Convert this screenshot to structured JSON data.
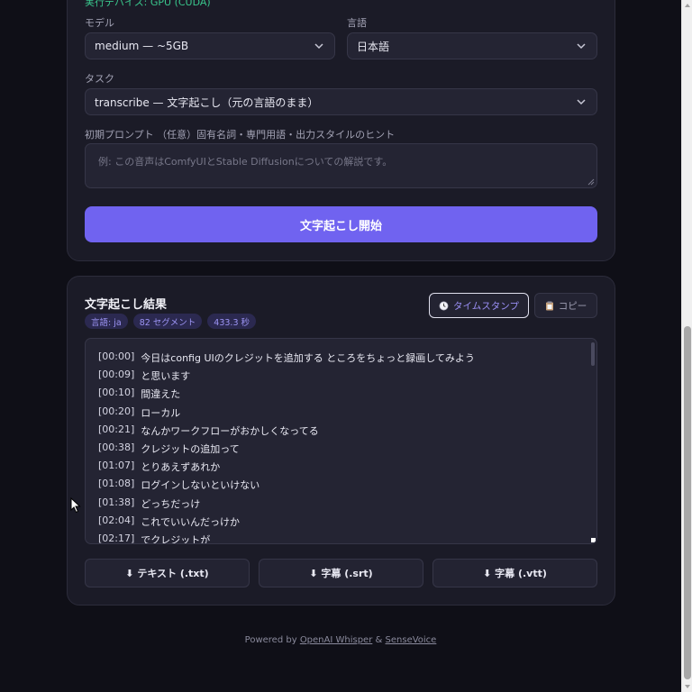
{
  "settings": {
    "cut_text": "実行デバイス: GPU (CUDA)",
    "model_label": "モデル",
    "model_value": "medium — ~5GB",
    "language_label": "言語",
    "language_value": "日本語",
    "task_label": "タスク",
    "task_value": "transcribe — 文字起こし（元の言語のまま）",
    "prompt_label": "初期プロンプト （任意）固有名詞・専門用語・出力スタイルのヒント",
    "prompt_placeholder": "例: この音声はComfyUIとStable Diffusionについての解説です。",
    "start_button": "文字起こし開始"
  },
  "result": {
    "title": "文字起こし結果",
    "badges": [
      "言語: ja",
      "82 セグメント",
      "433.3 秒"
    ],
    "timestamp_button": "タイムスタンプ",
    "copy_button": "コピー",
    "lines": [
      {
        "t": "[00:00]",
        "text": "今日はconfig UIのクレジットを追加する ところをちょっと録画してみよう"
      },
      {
        "t": "[00:09]",
        "text": "と思います"
      },
      {
        "t": "[00:10]",
        "text": "間違えた"
      },
      {
        "t": "[00:20]",
        "text": "ローカル"
      },
      {
        "t": "[00:21]",
        "text": "なんかワークフローがおかしくなってる"
      },
      {
        "t": "[00:38]",
        "text": "クレジットの追加って"
      },
      {
        "t": "[01:07]",
        "text": "とりあえずあれか"
      },
      {
        "t": "[01:08]",
        "text": "ログインしないといけない"
      },
      {
        "t": "[01:38]",
        "text": "どっちだっけ"
      },
      {
        "t": "[02:04]",
        "text": "これでいいんだっけか"
      },
      {
        "t": "[02:17]",
        "text": "でクレジットが"
      }
    ],
    "downloads": [
      "⬇ テキスト (.txt)",
      "⬇ 字幕 (.srt)",
      "⬇ 字幕 (.vtt)"
    ]
  },
  "footer": {
    "prefix": "Powered by",
    "link1": "OpenAI Whisper",
    "amp": "&",
    "link2": "SenseVoice"
  },
  "colors": {
    "accent": "#7063f0",
    "background": "#0f0f17",
    "card": "#1b1b27"
  }
}
